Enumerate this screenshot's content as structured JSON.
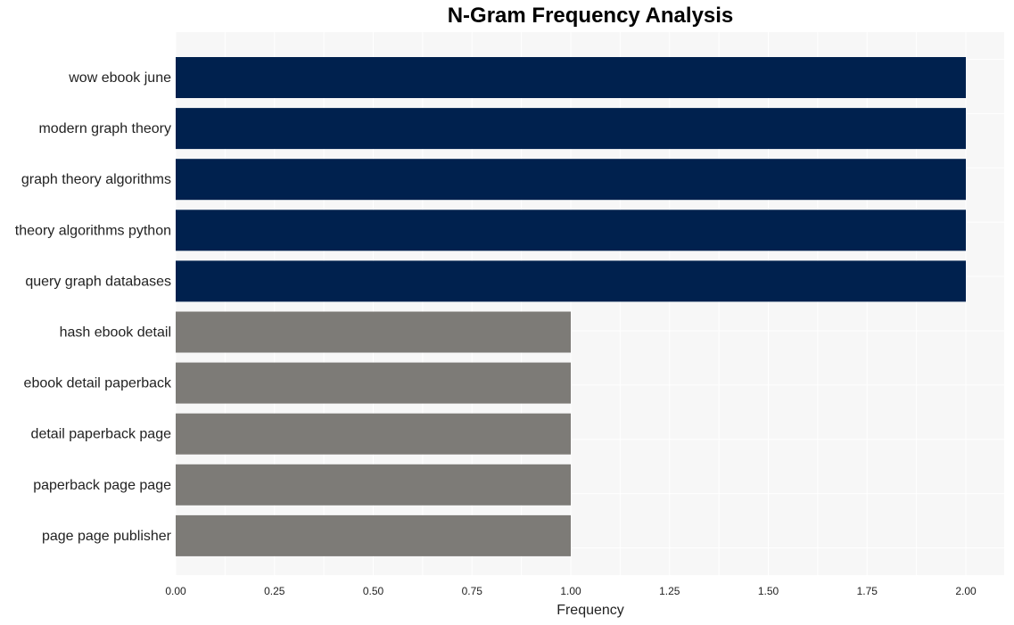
{
  "chart_data": {
    "type": "bar",
    "orientation": "horizontal",
    "title": "N-Gram Frequency Analysis",
    "xlabel": "Frequency",
    "ylabel": "",
    "xlim": [
      0,
      2.1
    ],
    "xticks": [
      "0.00",
      "0.25",
      "0.50",
      "0.75",
      "1.00",
      "1.25",
      "1.50",
      "1.75",
      "2.00"
    ],
    "grid": true,
    "categories": [
      "wow ebook june",
      "modern graph theory",
      "graph theory algorithms",
      "theory algorithms python",
      "query graph databases",
      "hash ebook detail",
      "ebook detail paperback",
      "detail paperback page",
      "paperback page page",
      "page page publisher"
    ],
    "values": [
      2,
      2,
      2,
      2,
      2,
      1,
      1,
      1,
      1,
      1
    ],
    "colors": {
      "high": "#00214e",
      "low": "#7d7b77",
      "plot_background": "#f7f7f7",
      "grid": "#ffffff"
    }
  }
}
